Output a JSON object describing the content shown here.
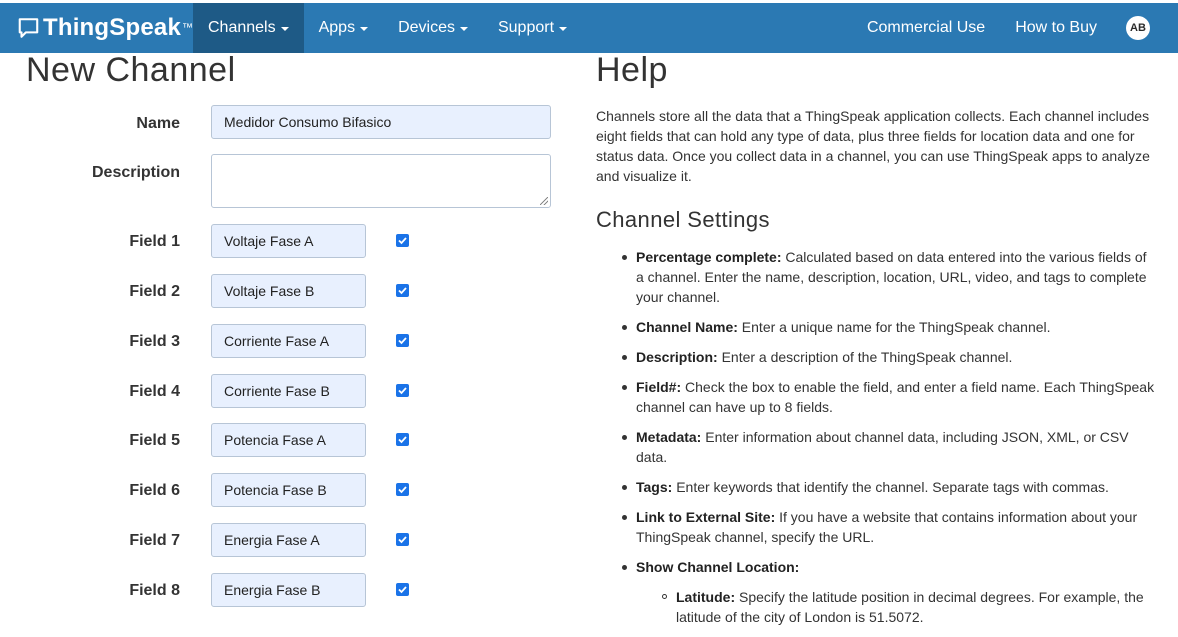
{
  "navbar": {
    "brand": "ThingSpeak",
    "brand_tm": "™",
    "menus": [
      "Channels",
      "Apps",
      "Devices",
      "Support"
    ],
    "active_menu": "Channels",
    "commercial": "Commercial Use",
    "how_to_buy": "How to Buy",
    "avatar_initials": "AB"
  },
  "form": {
    "title": "New Channel",
    "name_label": "Name",
    "name_value": "Medidor Consumo Bifasico",
    "description_label": "Description",
    "description_value": "",
    "fields": [
      {
        "label": "Field 1",
        "value": "Voltaje Fase A",
        "checked": true
      },
      {
        "label": "Field 2",
        "value": "Voltaje Fase B",
        "checked": true
      },
      {
        "label": "Field 3",
        "value": "Corriente Fase A",
        "checked": true
      },
      {
        "label": "Field 4",
        "value": "Corriente Fase B",
        "checked": true
      },
      {
        "label": "Field 5",
        "value": "Potencia Fase A",
        "checked": true
      },
      {
        "label": "Field 6",
        "value": "Potencia Fase B",
        "checked": true
      },
      {
        "label": "Field 7",
        "value": "Energia Fase A",
        "checked": true
      },
      {
        "label": "Field 8",
        "value": "Energia Fase B",
        "checked": true
      }
    ]
  },
  "help": {
    "title": "Help",
    "intro": "Channels store all the data that a ThingSpeak application collects. Each channel includes eight fields that can hold any type of data, plus three fields for location data and one for status data. Once you collect data in a channel, you can use ThingSpeak apps to analyze and visualize it.",
    "settings_title": "Channel Settings",
    "items": [
      {
        "term": "Percentage complete:",
        "text": " Calculated based on data entered into the various fields of a channel. Enter the name, description, location, URL, video, and tags to complete your channel."
      },
      {
        "term": "Channel Name:",
        "text": " Enter a unique name for the ThingSpeak channel."
      },
      {
        "term": "Description:",
        "text": " Enter a description of the ThingSpeak channel."
      },
      {
        "term": "Field#:",
        "text": " Check the box to enable the field, and enter a field name. Each ThingSpeak channel can have up to 8 fields."
      },
      {
        "term": "Metadata:",
        "text": " Enter information about channel data, including JSON, XML, or CSV data."
      },
      {
        "term": "Tags:",
        "text": " Enter keywords that identify the channel. Separate tags with commas."
      },
      {
        "term": "Link to External Site:",
        "text": " If you have a website that contains information about your ThingSpeak channel, specify the URL."
      },
      {
        "term": "Show Channel Location:",
        "text": ""
      }
    ],
    "sub_items": [
      {
        "term": "Latitude:",
        "text": " Specify the latitude position in decimal degrees. For example, the latitude of the city of London is 51.5072."
      }
    ]
  },
  "colors": {
    "navbar": "#2b79b3",
    "navbar_active": "#1e5a86",
    "input_bg": "#e8f0fe",
    "checkbox": "#1a73e8"
  }
}
